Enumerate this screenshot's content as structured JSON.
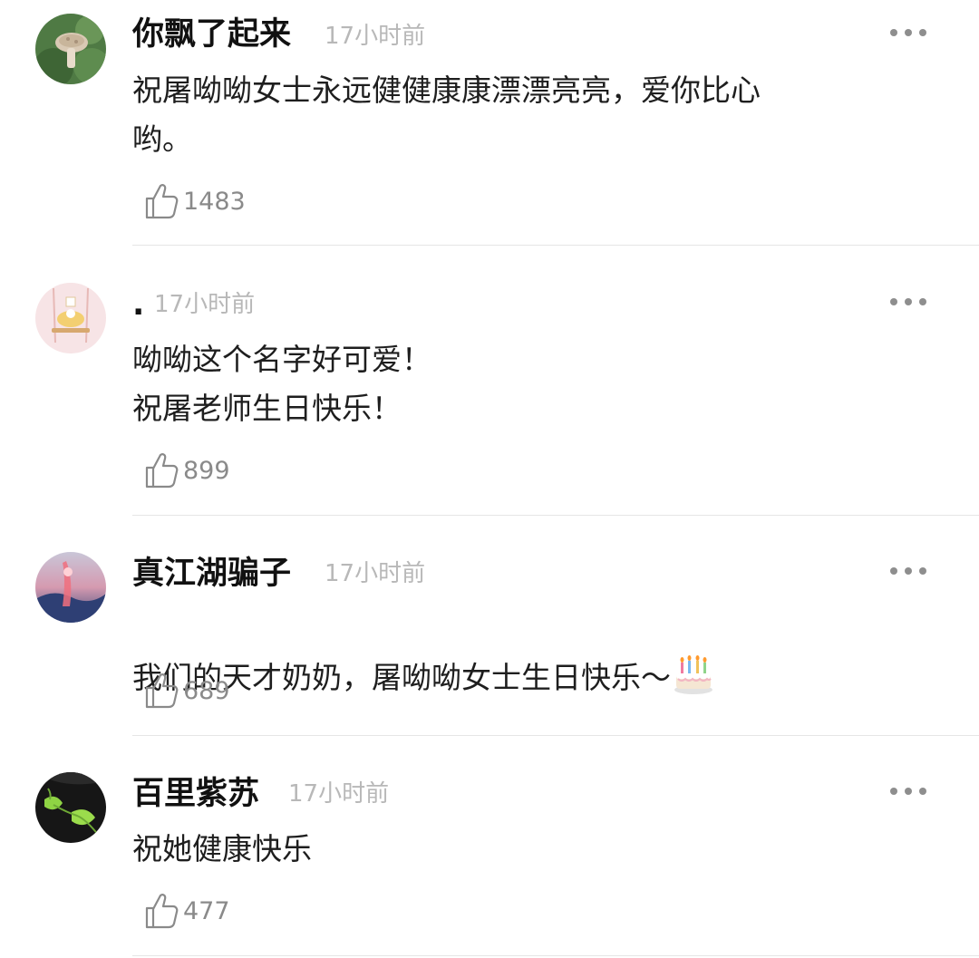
{
  "comments": [
    {
      "author": "你飘了起来",
      "time": "17小时前",
      "text": "祝屠呦呦女士永远健健康康漂漂亮亮，爱你比心\n哟。",
      "likes": "1483",
      "avatar_icon": "mushroom-avatar"
    },
    {
      "author": ".",
      "time": "17小时前",
      "text": "呦呦这个名字好可爱！\n祝屠老师生日快乐！",
      "likes": "899",
      "avatar_icon": "swing-avatar"
    },
    {
      "author": "真江湖骗子",
      "time": "17小时前",
      "text": "我们的天才奶奶，屠呦呦女士生日快乐～",
      "likes": "689",
      "avatar_icon": "sunset-avatar",
      "emoji": "birthday-cake-icon"
    },
    {
      "author": "百里紫苏",
      "time": "17小时前",
      "text": "祝她健康快乐",
      "likes": "477",
      "avatar_icon": "leaf-avatar"
    }
  ],
  "colors": {
    "author": "#111111",
    "time": "#b8b8b8",
    "body_text": "#1e1e1e",
    "like_count": "#8a8a8a",
    "divider": "#e6e6e6"
  }
}
